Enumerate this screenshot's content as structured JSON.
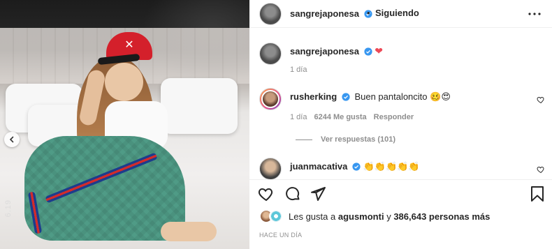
{
  "post": {
    "owner_username": "sangrejaponesa",
    "follow_separator": "•",
    "follow_status": "Siguiendo",
    "caption_emoji": "❤",
    "caption_age": "1 día"
  },
  "comments": [
    {
      "username": "rusherking",
      "text": "Buen pantaloncito",
      "emoji": "🥴😍",
      "age": "1 día",
      "likes": "6244 Me gusta",
      "reply_label": "Responder",
      "view_replies": "Ver respuestas (101)"
    },
    {
      "username": "juanmacativa",
      "emoji": "👏👏👏👏👏"
    }
  ],
  "likes": {
    "prefix": "Les gusta a",
    "first_user": "agusmonti",
    "conjunction": "y",
    "others": "386,643 personas más"
  },
  "timestamp": "HACE UN DÍA",
  "media_overlay_date": "6.19",
  "icons": {
    "more": "more-horizontal-icon",
    "verified": "verified-badge-icon",
    "like": "heart-icon",
    "comment": "comment-bubble-icon",
    "share": "paper-plane-icon",
    "save": "bookmark-icon",
    "prev": "chevron-left-icon"
  },
  "colors": {
    "verified": "#3897f0",
    "heart_red": "#ed4956",
    "text": "#262626",
    "muted": "#8e8e8e"
  }
}
